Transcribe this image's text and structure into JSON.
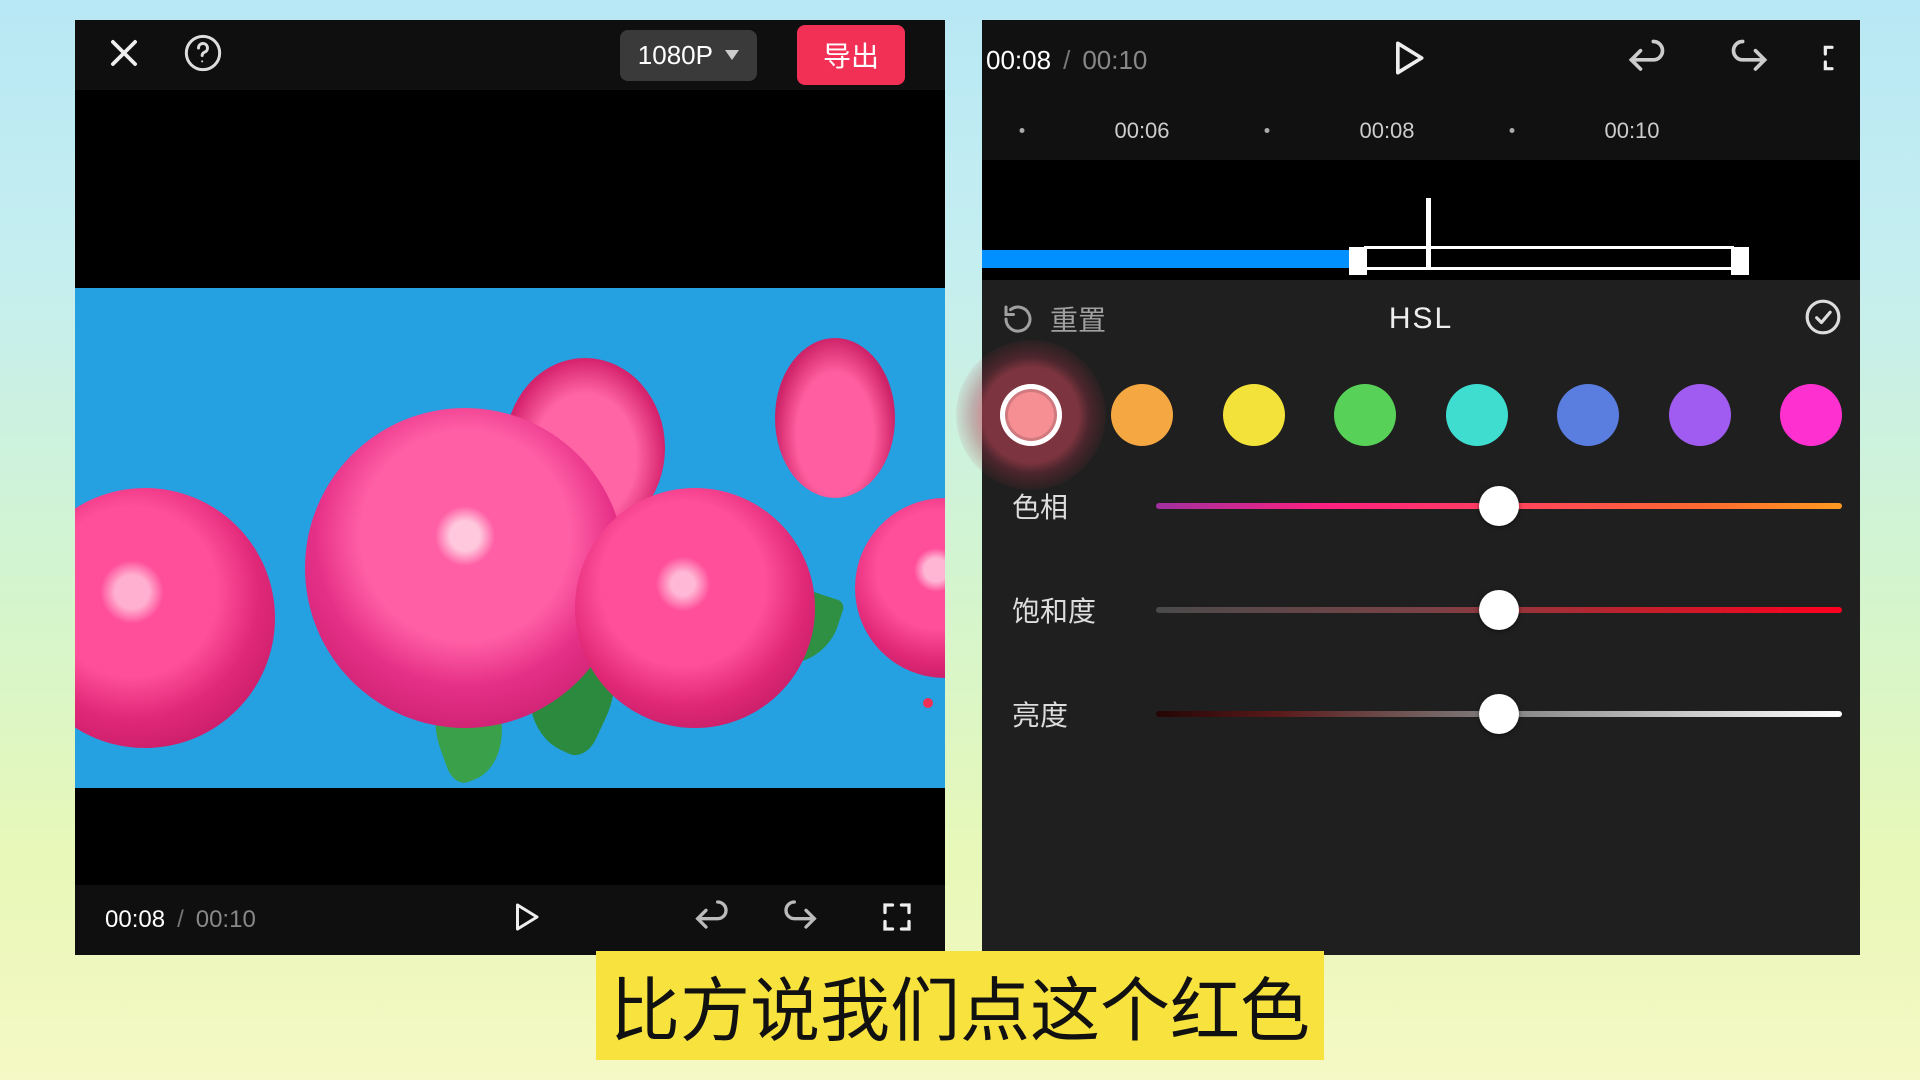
{
  "left": {
    "resolution_label": "1080P",
    "export_label": "导出",
    "time_current": "00:08",
    "time_total": "00:10"
  },
  "right": {
    "time_current": "00:08",
    "time_total": "00:10",
    "ruler": {
      "t1": "00:06",
      "t2": "00:08",
      "t3": "00:10"
    },
    "reset_label": "重置",
    "panel_title": "HSL",
    "colors": [
      {
        "name": "red",
        "hex": "#f58f94",
        "selected": true
      },
      {
        "name": "orange",
        "hex": "#f5a742",
        "selected": false
      },
      {
        "name": "yellow",
        "hex": "#f2e23a",
        "selected": false
      },
      {
        "name": "green",
        "hex": "#58d158",
        "selected": false
      },
      {
        "name": "cyan",
        "hex": "#3fdcd0",
        "selected": false
      },
      {
        "name": "blue",
        "hex": "#5a7de0",
        "selected": false
      },
      {
        "name": "purple",
        "hex": "#a05cf0",
        "selected": false
      },
      {
        "name": "magenta",
        "hex": "#ff30d0",
        "selected": false
      }
    ],
    "sliders": {
      "hue_label": "色相",
      "saturation_label": "饱和度",
      "luminance_label": "亮度",
      "hue_value": 50,
      "saturation_value": 50,
      "luminance_value": 50
    }
  },
  "subtitle": "比方说我们点这个红色"
}
